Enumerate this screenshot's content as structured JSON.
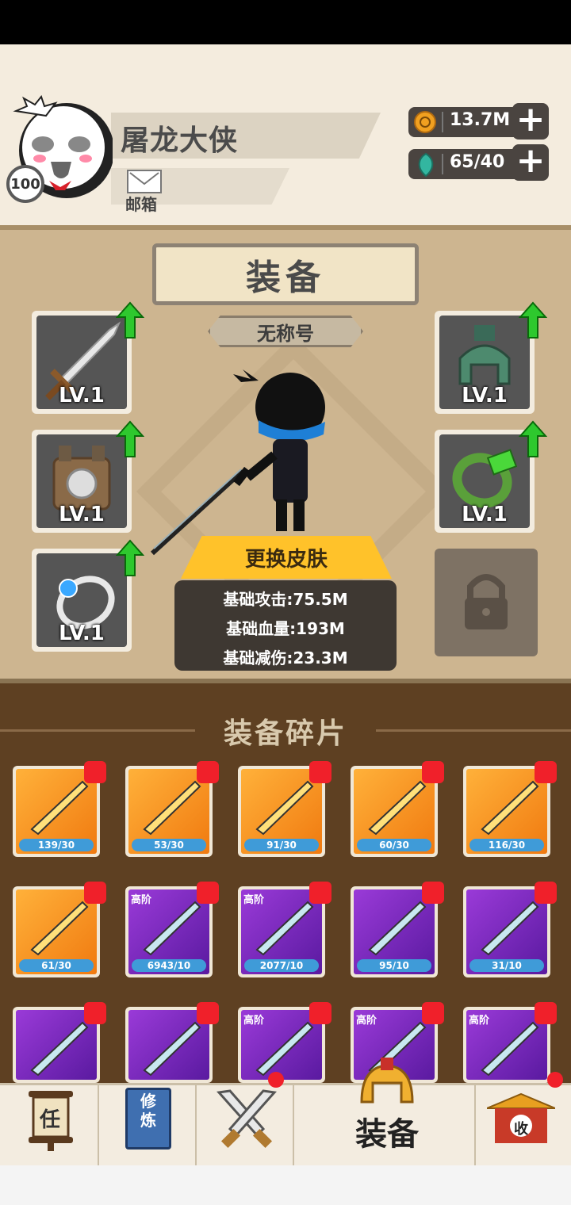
{
  "profile": {
    "player_name": "屠龙大侠",
    "level": "100",
    "mailbox_label": "邮箱"
  },
  "currencies": [
    {
      "name": "coin-icon",
      "value": "13.7M"
    },
    {
      "name": "gem-icon",
      "value": "65/40"
    }
  ],
  "equipment": {
    "title": "装备",
    "honor_title": "无称号",
    "slots": [
      {
        "name": "sword",
        "level": "LV.1",
        "upgrade": true
      },
      {
        "name": "helmet",
        "level": "LV.1",
        "upgrade": true
      },
      {
        "name": "armor",
        "level": "LV.1",
        "upgrade": true
      },
      {
        "name": "bracelet",
        "level": "LV.1",
        "upgrade": true
      },
      {
        "name": "ring",
        "level": "LV.1",
        "upgrade": true
      },
      {
        "name": "locked",
        "level": "",
        "upgrade": false
      }
    ],
    "change_skin_label": "更换皮肤",
    "stats": {
      "attack": "基础攻击:75.5M",
      "hp": "基础血量:193M",
      "damage_reduction": "基础减伤:23.3M"
    }
  },
  "fragments": {
    "title": "装备碎片",
    "items": [
      {
        "count": "139/30",
        "tier": "",
        "color": "orange"
      },
      {
        "count": "53/30",
        "tier": "",
        "color": "orange"
      },
      {
        "count": "91/30",
        "tier": "",
        "color": "orange"
      },
      {
        "count": "60/30",
        "tier": "",
        "color": "orange"
      },
      {
        "count": "116/30",
        "tier": "",
        "color": "orange"
      },
      {
        "count": "61/30",
        "tier": "",
        "color": "orange"
      },
      {
        "count": "6943/10",
        "tier": "高阶",
        "color": "purple"
      },
      {
        "count": "2077/10",
        "tier": "高阶",
        "color": "purple"
      },
      {
        "count": "95/10",
        "tier": "",
        "color": "purple"
      },
      {
        "count": "31/10",
        "tier": "",
        "color": "purple"
      },
      {
        "count": "",
        "tier": "",
        "color": "purple"
      },
      {
        "count": "",
        "tier": "",
        "color": "purple"
      },
      {
        "count": "",
        "tier": "高阶",
        "color": "purple"
      },
      {
        "count": "",
        "tier": "高阶",
        "color": "purple"
      },
      {
        "count": "",
        "tier": "高阶",
        "color": "purple"
      }
    ]
  },
  "bottom_nav": {
    "task_icon_char": "任",
    "cultivate_icon_text": "修炼",
    "shop_icon_char": "收",
    "active_label": "装备"
  }
}
